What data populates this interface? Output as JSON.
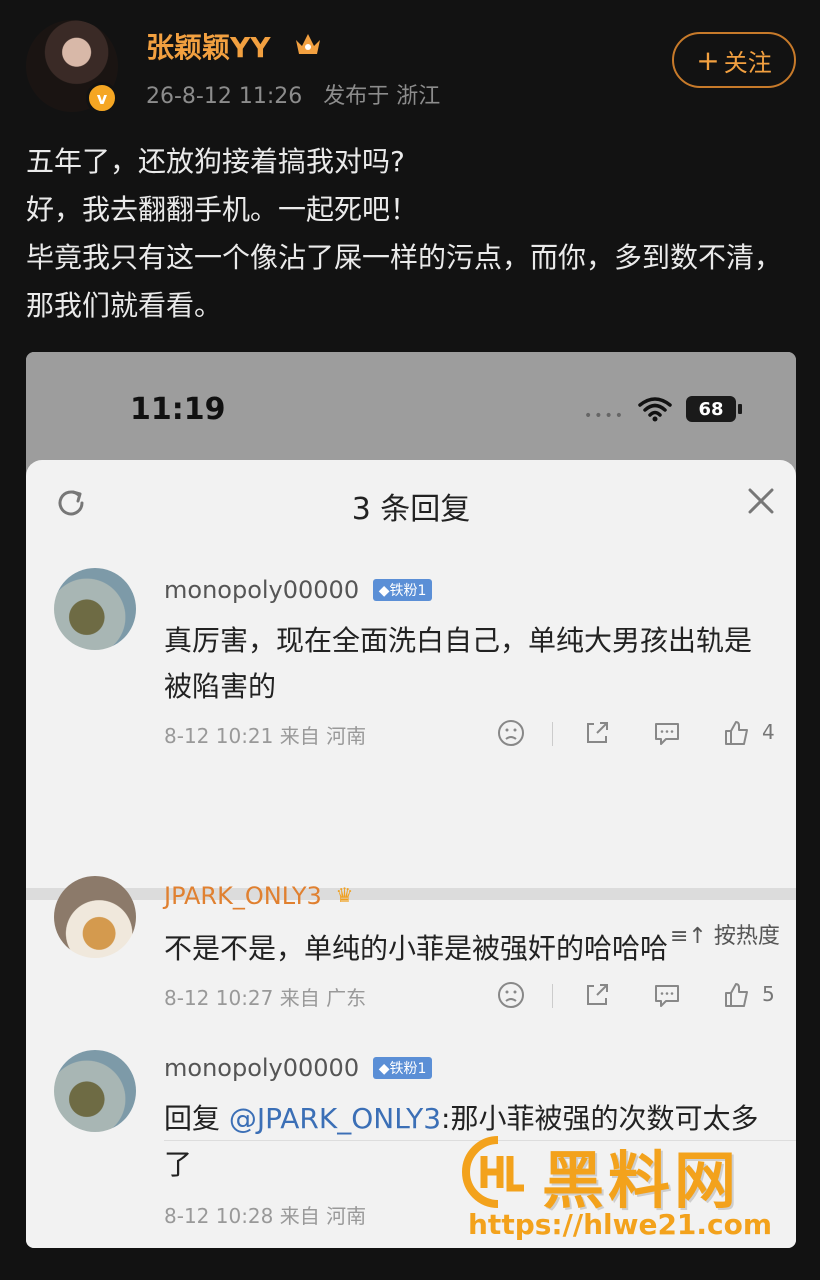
{
  "post": {
    "username": "张颖颖YY",
    "timestamp": "26-8-12 11:26",
    "location": "发布于 浙江",
    "follow_label": "关注",
    "follow_plus": "+",
    "verified_badge": "v",
    "lines": [
      "五年了，还放狗接着搞我对吗?",
      "好，我去翻翻手机。一起死吧！",
      "毕竟我只有这一个像沾了屎一样的污点，而你，多到数不清，那我们就看看。"
    ]
  },
  "screenshot": {
    "status_time": "11:19",
    "status_dots": "••••",
    "battery": "68",
    "sheet_title": "3 条回复",
    "sort_label": "按热度",
    "sort_icon": "≡↑",
    "comments": [
      {
        "name": "monopoly00000",
        "badge": "◆铁粉1",
        "text": "真厉害，现在全面洗白自己，单纯大男孩出轨是被陷害的",
        "meta": "8-12 10:21  来自 河南",
        "likes": "4"
      },
      {
        "name": "JPARK_ONLY3",
        "badge": "♛",
        "text": "不是不是，单纯的小菲是被强奸的哈哈哈",
        "meta": "8-12 10:27  来自 广东",
        "likes": "5"
      },
      {
        "name": "monopoly00000",
        "badge": "◆铁粉1",
        "reply_prefix": "回复 ",
        "mention": "@JPARK_ONLY3",
        "text": ":那小菲被强的次数可太多了",
        "meta": "8-12 10:28  来自 河南",
        "likes": ""
      }
    ]
  },
  "watermark": {
    "text": "黑料网",
    "url": "https://hlwe21.com"
  },
  "colors": {
    "accent_orange": "#f2a040",
    "background": "#121212",
    "sheet": "#f2f2f2",
    "mention": "#3b6fb6"
  }
}
